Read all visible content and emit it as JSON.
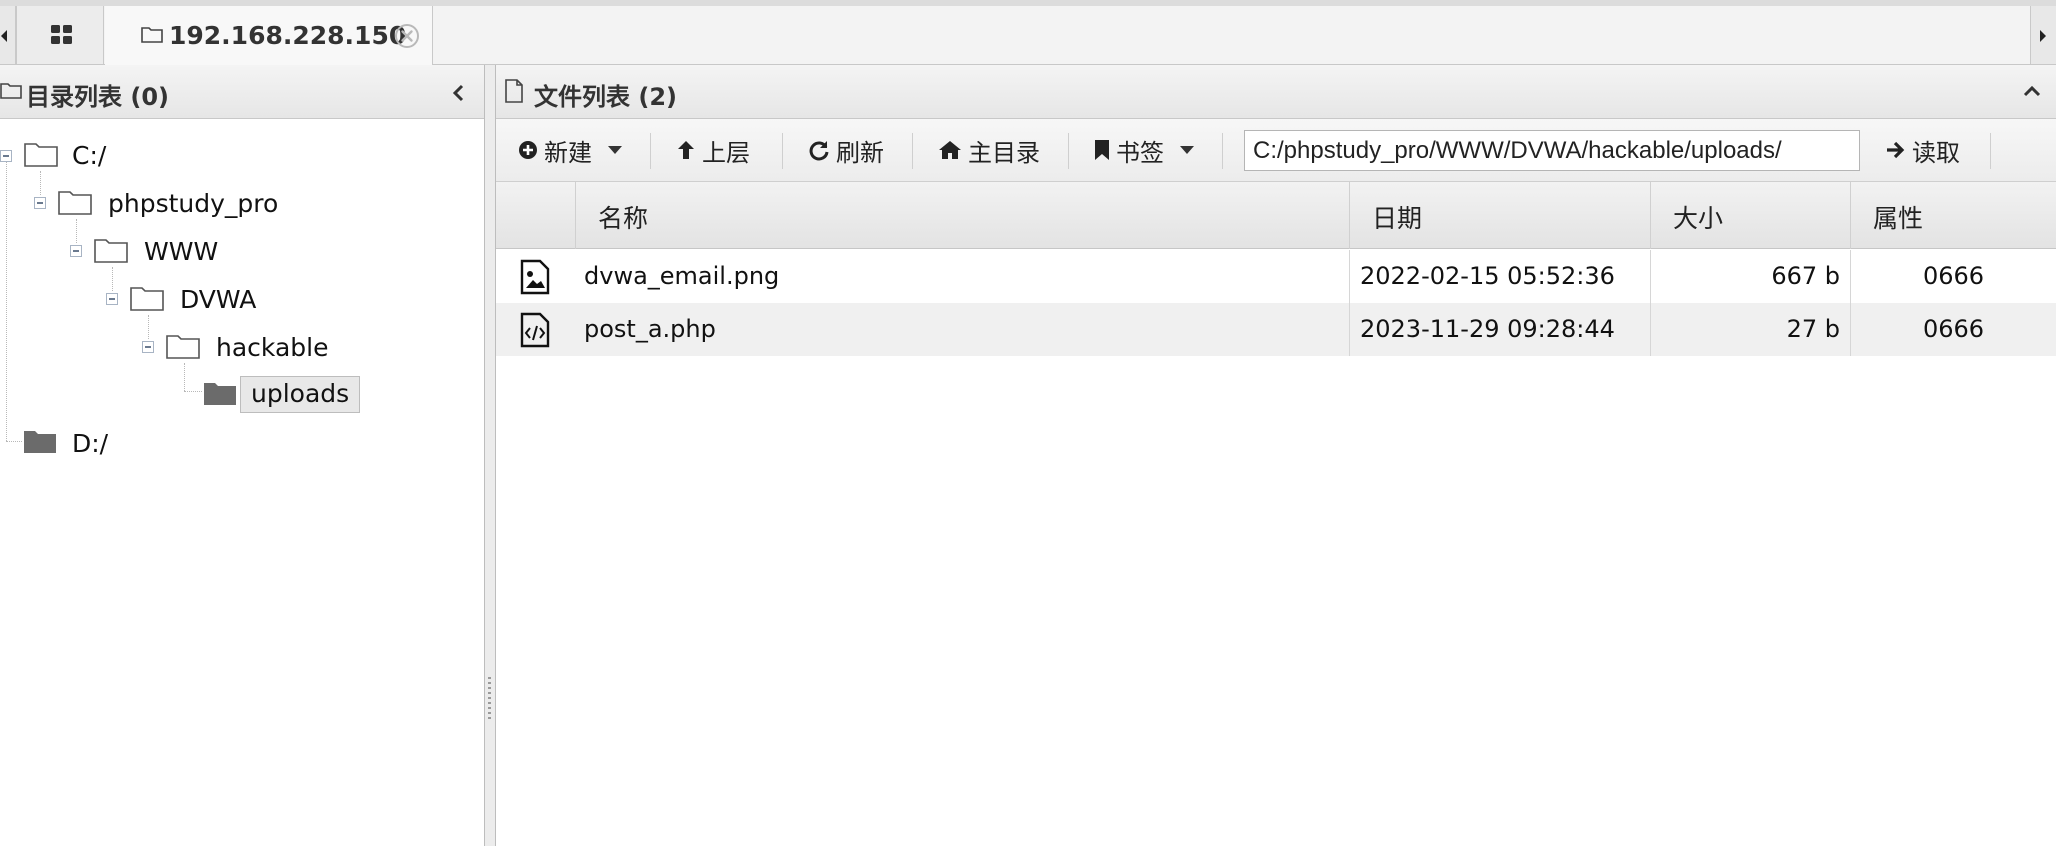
{
  "tabs": [
    {
      "label": "192.168.228.150",
      "closable": true
    }
  ],
  "left_panel": {
    "title": "目录列表 (0)",
    "tree": [
      {
        "label": "C:/",
        "depth": 0,
        "expanded": true,
        "selected": false
      },
      {
        "label": "phpstudy_pro",
        "depth": 1,
        "expanded": true,
        "selected": false
      },
      {
        "label": "WWW",
        "depth": 2,
        "expanded": true,
        "selected": false
      },
      {
        "label": "DVWA",
        "depth": 3,
        "expanded": true,
        "selected": false
      },
      {
        "label": "hackable",
        "depth": 4,
        "expanded": true,
        "selected": false
      },
      {
        "label": "uploads",
        "depth": 5,
        "expanded": false,
        "selected": true
      },
      {
        "label": "D:/",
        "depth": 0,
        "expanded": false,
        "selected": false
      }
    ]
  },
  "right_panel": {
    "title": "文件列表 (2)",
    "toolbar": {
      "new_label": "新建",
      "up_label": "上层",
      "refresh_label": "刷新",
      "home_label": "主目录",
      "bookmark_label": "书签",
      "read_label": "读取",
      "path_value": "C:/phpstudy_pro/WWW/DVWA/hackable/uploads/"
    },
    "columns": [
      "名称",
      "日期",
      "大小",
      "属性"
    ],
    "files": [
      {
        "icon": "image-file-icon",
        "name": "dvwa_email.png",
        "date": "2022-02-15 05:52:36",
        "size": "667 b",
        "attr": "0666"
      },
      {
        "icon": "code-file-icon",
        "name": "post_a.php",
        "date": "2023-11-29 09:28:44",
        "size": "27 b",
        "attr": "0666"
      }
    ]
  },
  "colors": {
    "header_bg": "#e9e9e9",
    "folder_closed": "#6b6b6b",
    "folder_open_outline": "#555555",
    "row_alt": "#f0f0f0"
  }
}
